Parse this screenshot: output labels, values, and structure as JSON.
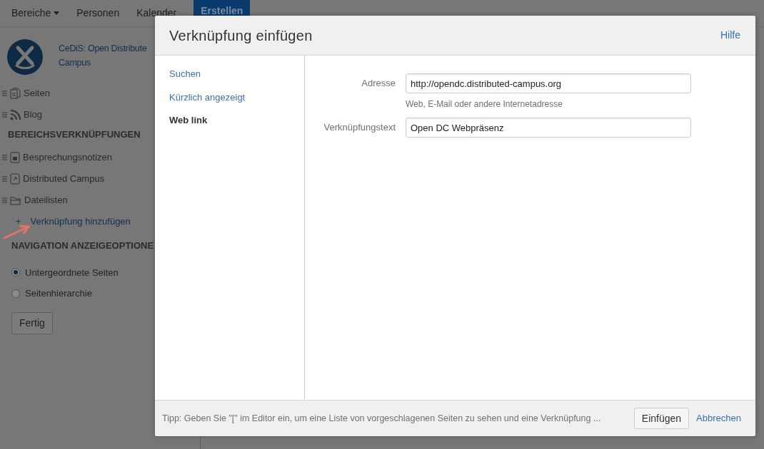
{
  "top_nav": {
    "items": [
      {
        "label": "Bereiche",
        "dropdown": true
      },
      {
        "label": "Personen",
        "dropdown": false
      },
      {
        "label": "Kalender",
        "dropdown": false
      }
    ],
    "create_button": "Erstellen"
  },
  "space": {
    "name_lines": [
      "CeDiS: Open Distribute",
      "Campus"
    ]
  },
  "sidebar": {
    "main_links": [
      {
        "label": "Seiten",
        "kind": "pages"
      },
      {
        "label": "Blog",
        "kind": "blog"
      }
    ],
    "shortcuts_heading": "BEREICHSVERKNÜPFUNGEN",
    "shortcuts": [
      {
        "label": "Besprechungsnotizen",
        "kind": "notes"
      },
      {
        "label": "Distributed Campus",
        "kind": "shortcut"
      },
      {
        "label": "Dateilisten",
        "kind": "folder"
      }
    ],
    "add_link": {
      "symbol": "+",
      "label": "Verknüpfung hinzufügen"
    },
    "nav_heading": "NAVIGATION ANZEIGEOPTIONE",
    "nav_options": [
      {
        "label": "Untergeordnete Seiten",
        "selected": true
      },
      {
        "label": "Seitenhierarchie",
        "selected": false
      }
    ],
    "done_button": "Fertig"
  },
  "dialog": {
    "title": "Verknüpfung einfügen",
    "help": "Hilfe",
    "nav": [
      {
        "label": "Suchen",
        "selected": false
      },
      {
        "label": "Kürzlich angezeigt",
        "selected": false
      },
      {
        "label": "Web link",
        "selected": true
      }
    ],
    "fields": [
      {
        "label": "Adresse",
        "value": "http://opendc.distributed-campus.org",
        "hint": "Web, E-Mail oder andere Internetadresse"
      },
      {
        "label": "Verknüpfungstext",
        "value": "Open DC Webpräsenz"
      }
    ],
    "tip": "Tipp: Geben Sie \"[\" im Editor ein, um eine Liste von vorgeschlagenen Seiten zu sehen und eine Verknüpfung ...",
    "insert_button": "Einfügen",
    "cancel_link": "Abbrechen"
  }
}
